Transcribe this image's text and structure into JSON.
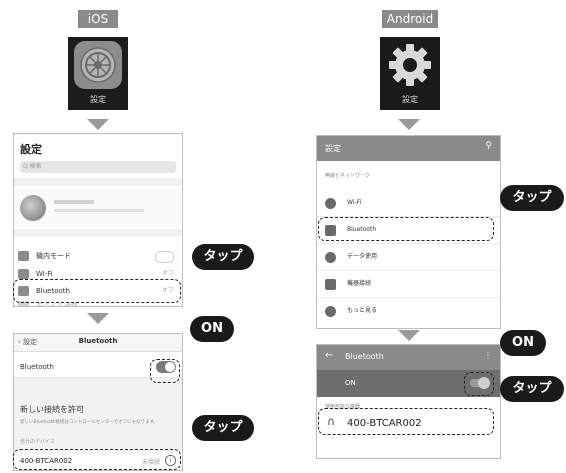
{
  "ios": {
    "platform_label": "iOS",
    "icon_caption": "設定",
    "settings": {
      "title": "設定",
      "search_placeholder": "Q 検索",
      "items": [
        {
          "label": "機内モード",
          "value": ""
        },
        {
          "label": "Wi-Fi",
          "value": "オフ"
        },
        {
          "label": "Bluetooth",
          "value": "オフ"
        },
        {
          "label": "モバイル通信",
          "value": ""
        }
      ]
    },
    "bluetooth": {
      "back_label": "設定",
      "title": "Bluetooth",
      "toggle_label": "Bluetooth",
      "toggle_on": true,
      "pairing_heading": "新しい接続を許可",
      "note": "新しいBluetooth接続はコントロールセンターでオフにもなります。",
      "devices_header": "自分のデバイス",
      "device_name": "400-BTCAR002",
      "device_status": "未接続"
    },
    "callout_tap_1": "タップ",
    "callout_on": "ON",
    "callout_tap_2": "タップ"
  },
  "android": {
    "platform_label": "Android",
    "icon_caption": "設定",
    "settings": {
      "title": "設定",
      "section_header": "無線とネットワーク",
      "items": [
        {
          "label": "Wi-Fi"
        },
        {
          "label": "Bluetooth"
        },
        {
          "label": "データ使用"
        },
        {
          "label": "機器接続"
        },
        {
          "label": "もっと見る"
        }
      ]
    },
    "bluetooth": {
      "title": "Bluetooth",
      "toggle_label": "ON",
      "toggle_on": true,
      "section_header": "使用可能な機器",
      "device_name": "400-BTCAR002"
    },
    "callout_tap_1": "タップ",
    "callout_on": "ON",
    "callout_tap_2": "タップ"
  }
}
